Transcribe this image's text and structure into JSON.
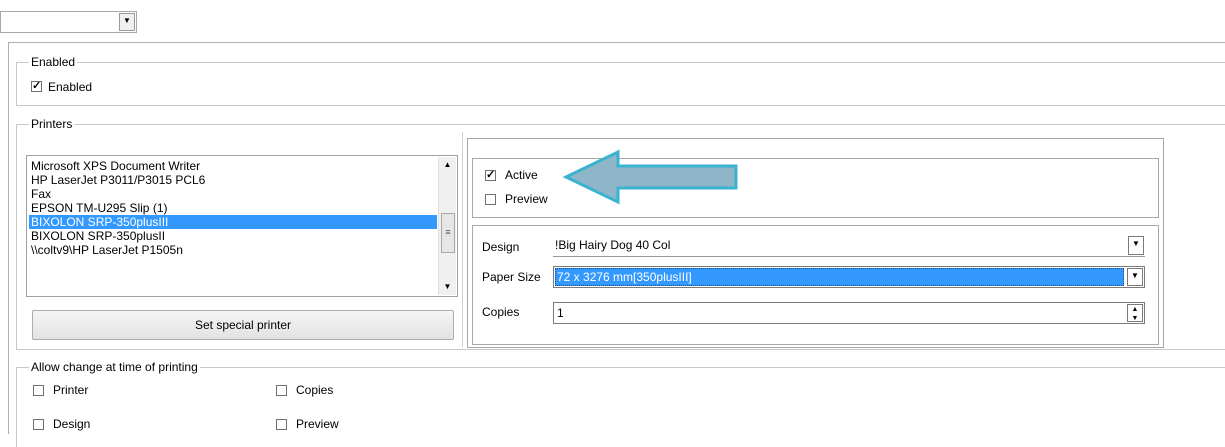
{
  "top_combo": {
    "value": ""
  },
  "enabled_group": {
    "legend": "Enabled",
    "checkbox_label": "Enabled",
    "checked": true
  },
  "printers_group": {
    "legend": "Printers",
    "printer_list": [
      "Microsoft XPS Document Writer",
      "HP LaserJet P3011/P3015 PCL6",
      "Fax",
      "EPSON TM-U295 Slip (1)",
      "BIXOLON SRP-350plusIII",
      "BIXOLON SRP-350plusII",
      "\\\\coltv9\\HP LaserJet P1505n"
    ],
    "selected_index": 4,
    "set_special_printer_label": "Set special printer"
  },
  "printer_settings": {
    "active_label": "Active",
    "active_checked": true,
    "preview_label": "Preview",
    "preview_checked": false,
    "design_label": "Design",
    "design_value": "!Big Hairy Dog 40 Col",
    "paper_size_label": "Paper Size",
    "paper_size_value": "72 x 3276 mm[350plusIII]",
    "copies_label": "Copies",
    "copies_value": "1"
  },
  "allow_change_group": {
    "legend": "Allow change at time of printing",
    "printer_label": "Printer",
    "copies_label": "Copies",
    "design_label": "Design",
    "preview_label": "Preview"
  },
  "colors": {
    "selection": "#3399ff",
    "arrow_fill": "#8fb5c8",
    "arrow_border": "#3ab3d0"
  }
}
